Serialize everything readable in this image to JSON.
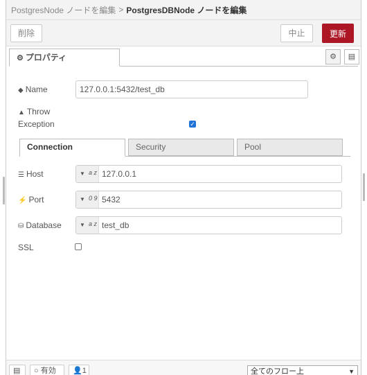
{
  "breadcrumb": {
    "previous": "PostgresNode ノードを編集",
    "separator": ">",
    "current": "PostgresDBNode ノードを編集"
  },
  "toolbar": {
    "delete_label": "削除",
    "cancel_label": "中止",
    "update_label": "更新"
  },
  "tabs": {
    "properties_label": "プロパティ"
  },
  "form": {
    "name_label": "Name",
    "name_value": "127.0.0.1:5432/test_db",
    "throw_label_line1": "Throw",
    "throw_label_line2": "Exception",
    "throw_checked": true
  },
  "subtabs": [
    {
      "label": "Connection",
      "active": true
    },
    {
      "label": "Security",
      "active": false
    },
    {
      "label": "Pool",
      "active": false
    }
  ],
  "connection": {
    "host_label": "Host",
    "host_type": "a z",
    "host_value": "127.0.0.1",
    "port_label": "Port",
    "port_type": "0 9",
    "port_value": "5432",
    "database_label": "Database",
    "database_type": "a z",
    "database_value": "test_db",
    "ssl_label": "SSL",
    "ssl_checked": false
  },
  "footer": {
    "enabled_label": "有効",
    "users_count": "1",
    "flow_scope": "全てのフロー上"
  },
  "colors": {
    "accent": "#ad1625",
    "checkbox": "#1e72d8"
  }
}
